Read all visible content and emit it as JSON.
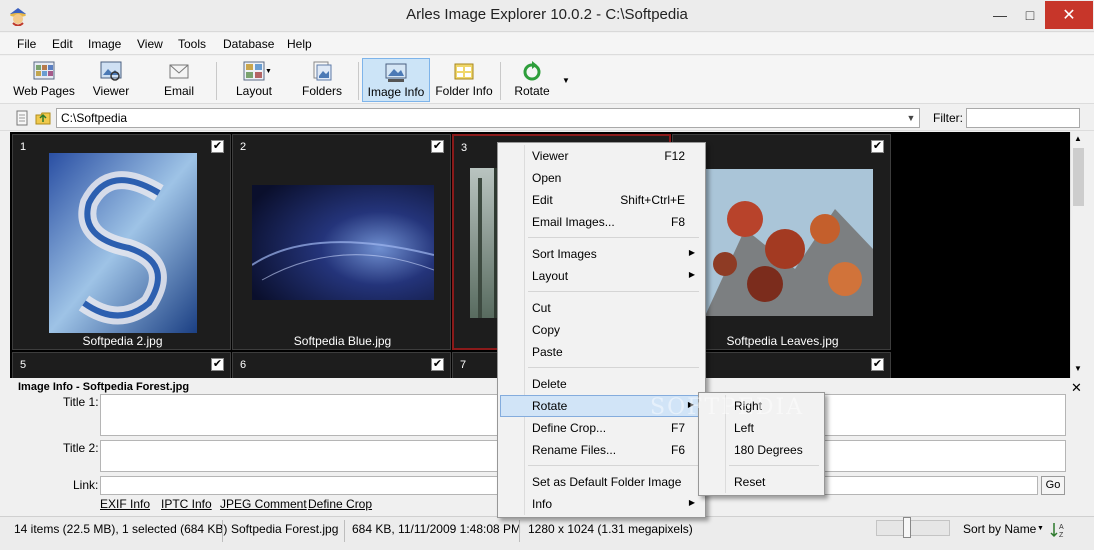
{
  "window": {
    "title": "Arles Image Explorer 10.0.2 - C:\\Softpedia",
    "minimize_icon": "minimize-icon",
    "maximize_icon": "maximize-icon",
    "close_icon": "close-icon"
  },
  "menubar": {
    "items": [
      "File",
      "Edit",
      "Image",
      "View",
      "Tools",
      "Database",
      "Help"
    ]
  },
  "toolbar": {
    "buttons": [
      {
        "label": "Web Pages",
        "icon": "web-pages-icon"
      },
      {
        "label": "Viewer",
        "icon": "viewer-icon"
      },
      {
        "label": "Email",
        "icon": "email-icon"
      },
      {
        "label": "Layout",
        "icon": "layout-icon"
      },
      {
        "label": "Folders",
        "icon": "folders-icon"
      },
      {
        "label": "Image Info",
        "icon": "image-info-icon",
        "active": true
      },
      {
        "label": "Folder Info",
        "icon": "folder-info-icon"
      },
      {
        "label": "Rotate",
        "icon": "rotate-icon"
      }
    ],
    "accent": "#cce4f7"
  },
  "pathbar": {
    "path": "C:\\Softpedia",
    "filter_label": "Filter:",
    "filter_value": ""
  },
  "grid": {
    "cells": [
      {
        "num": "1",
        "name": "Softpedia 2.jpg",
        "checked": true
      },
      {
        "num": "2",
        "name": "Softpedia Blue.jpg",
        "checked": true
      },
      {
        "num": "3",
        "name": "Softpedia Forest.jpg",
        "checked": true,
        "selected": true
      },
      {
        "num": "4",
        "name": "Softpedia Leaves.jpg",
        "checked": true
      }
    ],
    "row2": [
      {
        "num": "5",
        "checked": true
      },
      {
        "num": "6",
        "checked": true
      },
      {
        "num": "7",
        "checked": true
      },
      {
        "num": "8",
        "checked": true
      }
    ],
    "check_mark": "✔"
  },
  "info_panel": {
    "title": "Image Info - Softpedia Forest.jpg",
    "title1_label": "Title 1:",
    "title2_label": "Title 2:",
    "link_label": "Link:",
    "go_label": "Go",
    "tabs": [
      "EXIF Info",
      "IPTC Info",
      "JPEG Comment",
      "Define Crop"
    ]
  },
  "statusbar": {
    "items_text": "14 items (22.5 MB), 1 selected (684 KB)",
    "filename": "Softpedia Forest.jpg",
    "file_info": "684 KB, 11/11/2009 1:48:08 PM",
    "dimensions": "1280 x 1024 (1.31 megapixels)",
    "sort_label": "Sort by Name",
    "zoom_fraction": 0.4
  },
  "context_menu": {
    "items": [
      {
        "label": "Viewer",
        "key": "F12"
      },
      {
        "label": "Open",
        "key": ""
      },
      {
        "label": "Edit",
        "key": "Shift+Ctrl+E"
      },
      {
        "label": "Email Images...",
        "key": "F8"
      },
      {
        "label": "Sort Images",
        "submenu": true
      },
      {
        "label": "Layout",
        "submenu": true
      },
      {
        "label": "Cut",
        "key": ""
      },
      {
        "label": "Copy",
        "key": ""
      },
      {
        "label": "Paste",
        "key": ""
      },
      {
        "label": "Delete",
        "key": ""
      },
      {
        "label": "Rotate",
        "submenu": true,
        "highlighted": true
      },
      {
        "label": "Define Crop...",
        "key": "F7"
      },
      {
        "label": "Rename Files...",
        "key": "F6"
      },
      {
        "label": "Set as Default Folder Image",
        "key": ""
      },
      {
        "label": "Info",
        "submenu": true
      }
    ],
    "highlight_color": "#d1e4f7"
  },
  "rotate_submenu": {
    "items": [
      "Right",
      "Left",
      "180 Degrees",
      "Reset"
    ]
  },
  "watermark": "SOFTPEDIA"
}
